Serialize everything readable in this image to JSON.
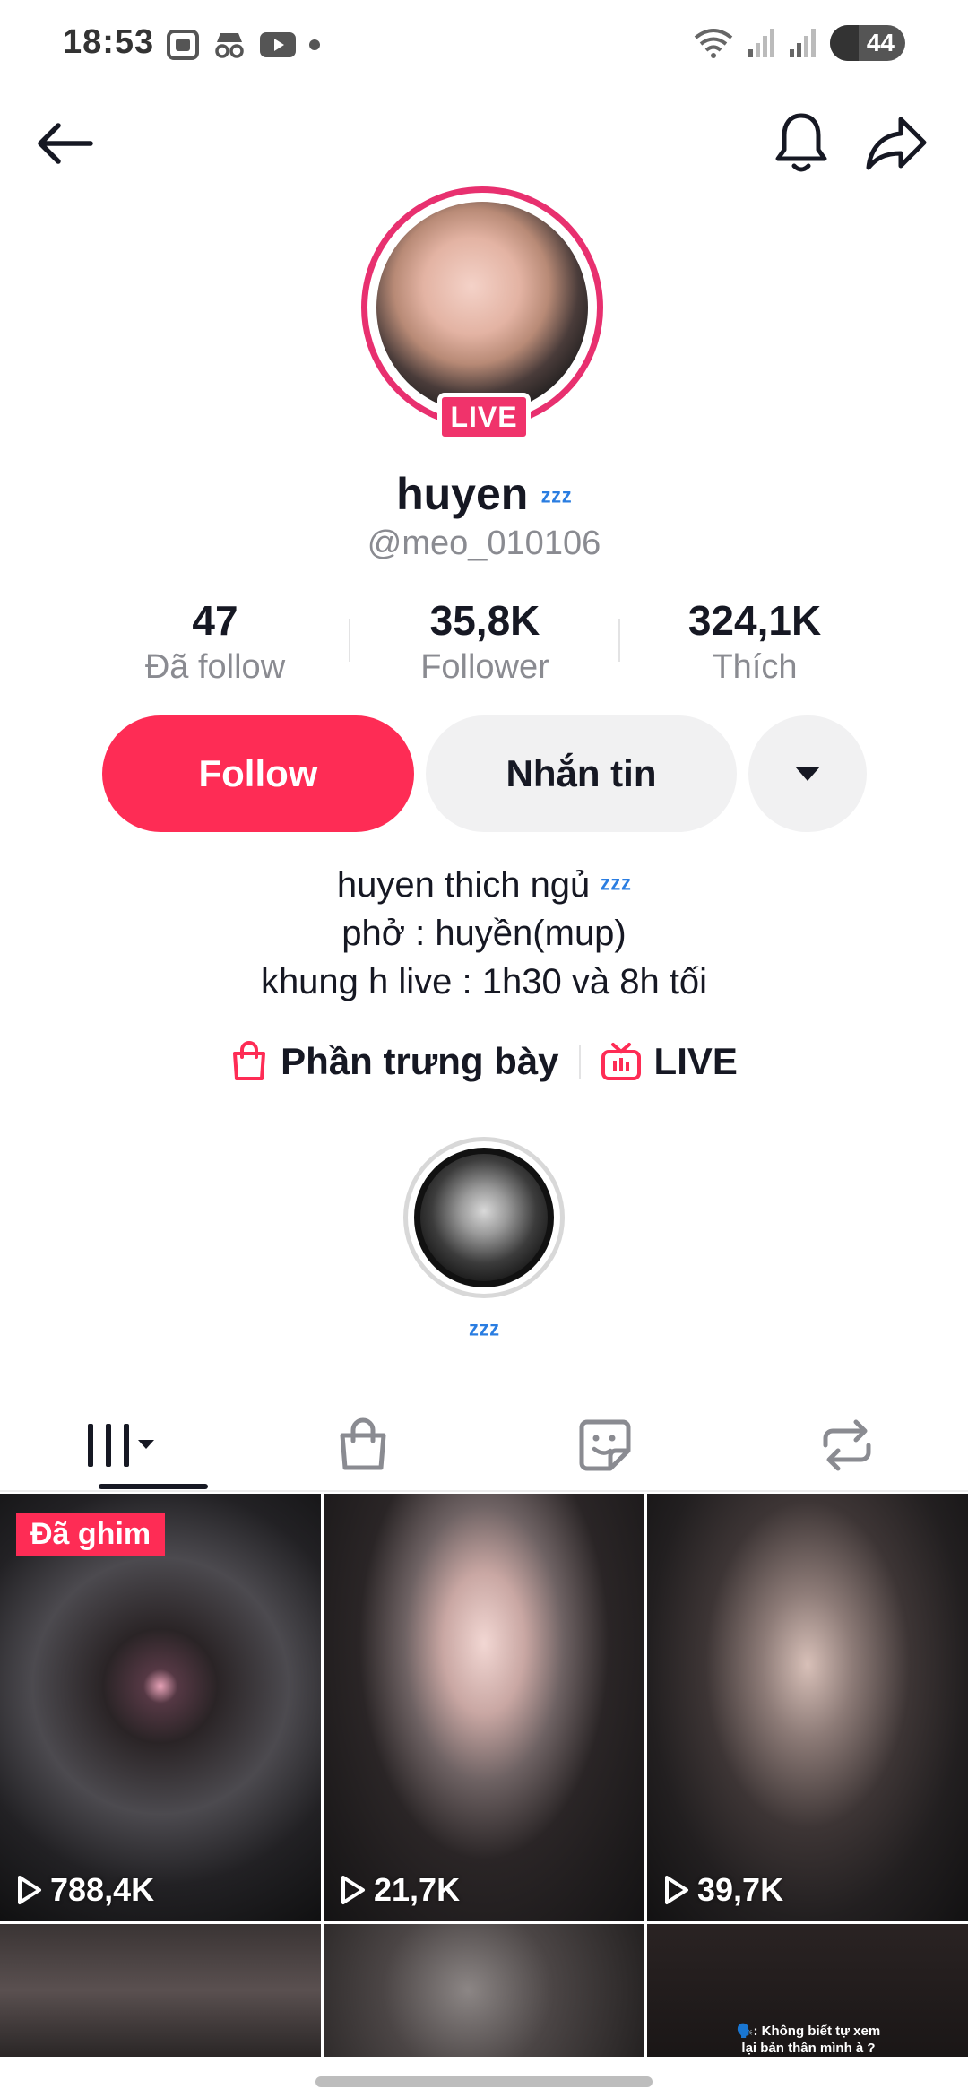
{
  "status_bar": {
    "time": "18:53",
    "battery": "44"
  },
  "header": {
    "back_icon": "arrow-left-icon",
    "bell_icon": "bell-icon",
    "share_icon": "share-icon"
  },
  "profile": {
    "live_label": "LIVE",
    "name": "huyen",
    "name_emoji": "ᶻᶻᶻ",
    "handle": "@meo_010106"
  },
  "stats": [
    {
      "value": "47",
      "label": "Đã follow"
    },
    {
      "value": "35,8K",
      "label": "Follower"
    },
    {
      "value": "324,1K",
      "label": "Thích"
    }
  ],
  "actions": {
    "follow_label": "Follow",
    "message_label": "Nhắn tin"
  },
  "bio": {
    "line1": "huyen thich ngủ",
    "line1_emoji": "ᶻᶻᶻ",
    "line2": "phở : huyền(mup)",
    "line3": "khung h live : 1h30 và 8h tối"
  },
  "links": {
    "showcase_label": "Phần trưng bày",
    "live_label": "LIVE"
  },
  "highlight": {
    "label": "ᶻᶻᶻ"
  },
  "tabs": [
    {
      "icon": "grid-icon",
      "active": true
    },
    {
      "icon": "shopping-bag-icon",
      "active": false
    },
    {
      "icon": "sticker-icon",
      "active": false
    },
    {
      "icon": "repost-icon",
      "active": false
    }
  ],
  "videos": [
    {
      "views": "788,4K",
      "pinned_label": "Đã ghim"
    },
    {
      "views": "21,7K"
    },
    {
      "views": "39,7K"
    },
    {
      "views": ""
    },
    {
      "views": ""
    },
    {
      "views": "",
      "caption_line1": "🗣️: Không biết tự xem",
      "caption_line2": "lại bản thân mình à ?"
    }
  ],
  "colors": {
    "accent": "#fe2c55",
    "live_ring": "#e8306f",
    "secondary_text": "#8a8b91",
    "button_bg": "#f1f1f2"
  }
}
